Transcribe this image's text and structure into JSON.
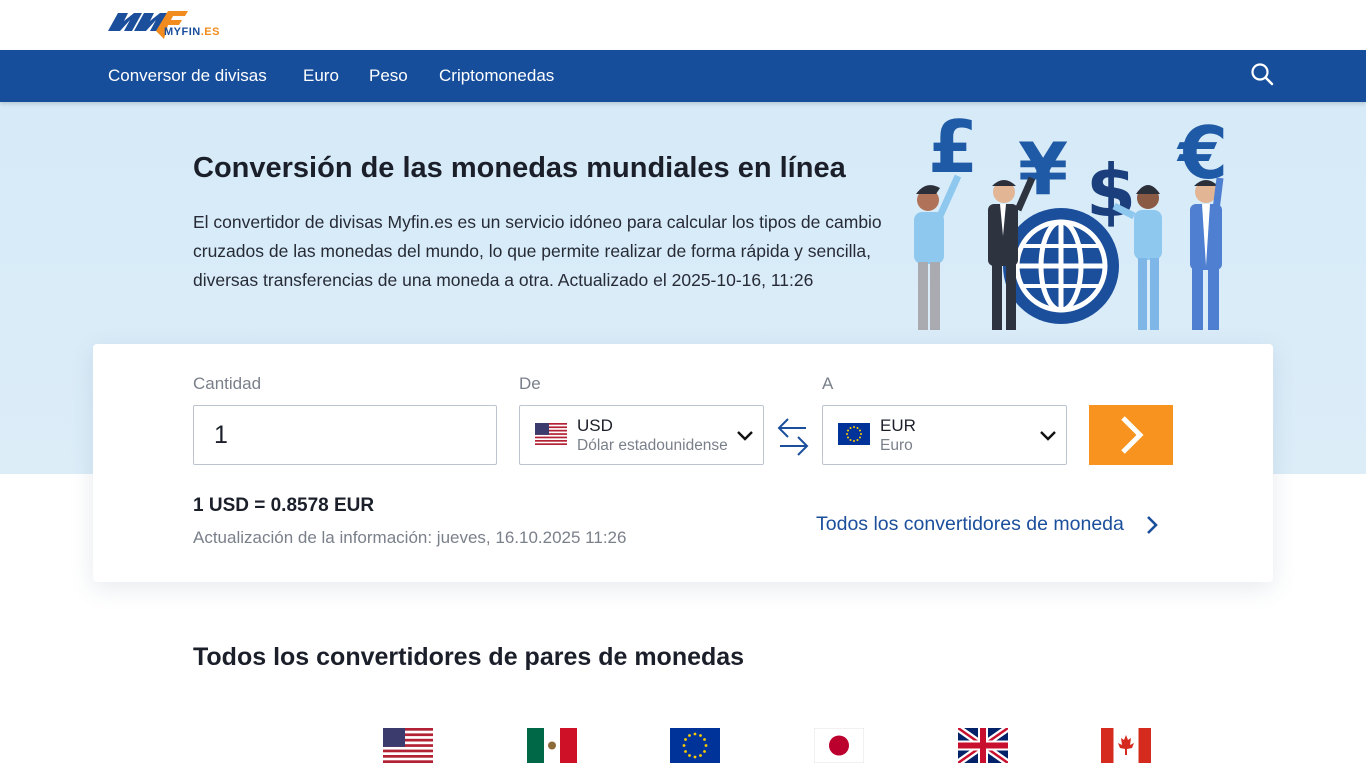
{
  "logo": {
    "text": "MYFIN",
    "tld": ".ES"
  },
  "nav": {
    "items": [
      "Conversor de divisas",
      "Euro",
      "Peso",
      "Criptomonedas"
    ],
    "search_icon": "search-icon"
  },
  "hero": {
    "title": "Conversión de las monedas mundiales en línea",
    "description": "El convertidor de divisas Myfin.es es un servicio idóneo para calcular los tipos de cambio cruzados de las monedas del mundo, lo que permite realizar de forma rápida y sencilla, diversas transferencias de una moneda a otra. Actualizado el 2025-10-16, 11:26",
    "illustration_icon": "currency-people-illustration"
  },
  "converter": {
    "amount_label": "Cantidad",
    "amount_value": "1",
    "from_label": "De",
    "from": {
      "code": "USD",
      "name": "Dólar estadounidense",
      "flag_icon": "us-flag-icon"
    },
    "to_label": "A",
    "to": {
      "code": "EUR",
      "name": "Euro",
      "flag_icon": "eu-flag-icon"
    },
    "swap_icon": "swap-arrows-icon",
    "go_icon": "chevron-right-icon",
    "result": "1 USD = 0.8578 EUR",
    "updated": "Actualización de la información: jueves, 16.10.2025 11:26",
    "all_link": "Todos los convertidores de moneda"
  },
  "pairs": {
    "title": "Todos los convertidores de pares de monedas",
    "flags": [
      "us-flag-icon",
      "mx-flag-icon",
      "eu-flag-icon",
      "jp-flag-icon",
      "gb-flag-icon",
      "ca-flag-icon"
    ]
  },
  "colors": {
    "nav_bg": "#174e9b",
    "hero_bg": "#d6eaf8",
    "accent_orange": "#f7931e",
    "link_blue": "#1b4f9c"
  }
}
